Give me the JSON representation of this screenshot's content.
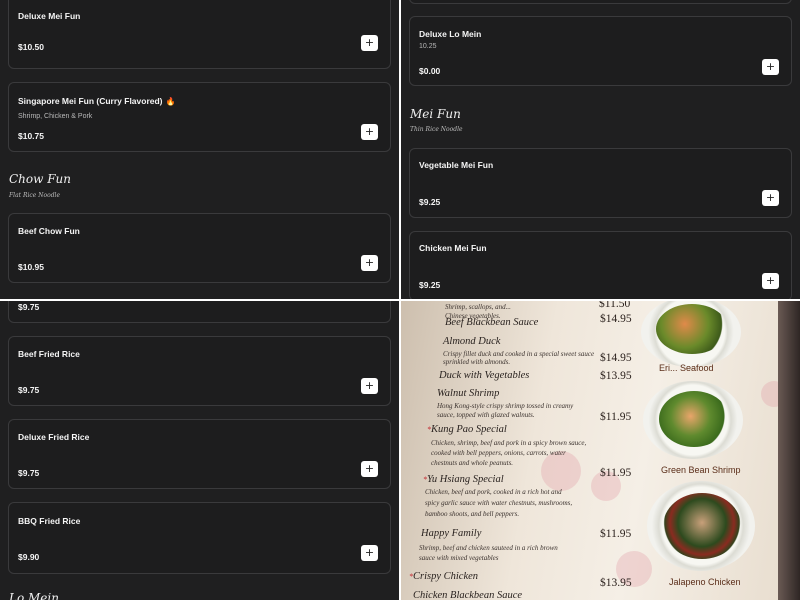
{
  "top_left": {
    "items": [
      {
        "name": "Deluxe Mei Fun",
        "price": "$10.50"
      },
      {
        "name": "Singapore Mei Fun (Curry Flavored)",
        "desc": "Shrimp, Chicken & Pork",
        "price": "$10.75"
      }
    ],
    "category": {
      "title": "Chow Fun",
      "subtitle": "Flat Rice Noodle"
    },
    "items2": [
      {
        "name": "Beef Chow Fun",
        "price": "$10.95"
      }
    ]
  },
  "top_right": {
    "items": [
      {
        "name": "Deluxe Lo Mein",
        "desc": "10.25",
        "price": "$0.00"
      }
    ],
    "category": {
      "title": "Mei Fun",
      "subtitle": "Thin Rice Noodle"
    },
    "items2": [
      {
        "name": "Vegetable Mei Fun",
        "price": "$9.25"
      },
      {
        "name": "Chicken Mei Fun",
        "price": "$9.25"
      }
    ]
  },
  "bottom_left": {
    "items": [
      {
        "price": "$9.75"
      },
      {
        "name": "Beef Fried Rice",
        "price": "$9.75"
      },
      {
        "name": "Deluxe Fried Rice",
        "price": "$9.75"
      },
      {
        "name": "BBQ Fried Rice",
        "price": "$9.90"
      }
    ],
    "partial_category": "Lo Mein"
  },
  "add_symbol": "+",
  "photo_menu": {
    "items": [
      {
        "name": "Shrimp, scallops, and...",
        "price": "$11.50",
        "desc": "Chinese vegetables."
      },
      {
        "name": "Beef Blackbean Sauce",
        "price": "$14.95"
      },
      {
        "name": "Almond Duck",
        "price": "$14.95",
        "desc1": "Crispy fillet duck and cooked in a special sweet sauce",
        "desc2": "sprinkled with almonds."
      },
      {
        "name": "Duck with Vegetables",
        "price": "$13.95"
      },
      {
        "name": "Walnut Shrimp",
        "price": "",
        "desc1": "Hong Kong-style crispy shrimp tossed in creamy",
        "desc2": "sauce, topped with glazed walnuts."
      },
      {
        "name": "Kung Pao Special",
        "price": "$11.95",
        "desc1": "Chicken, shrimp, beef and pork in a spicy brown sauce,",
        "desc2": "cooked with bell peppers, onions, carrots, water",
        "desc3": "chestnuts and whole peanuts."
      },
      {
        "name": "Yu Hsiang Special",
        "price": "$11.95",
        "desc1": "Chicken, beef and pork, cooked in a rich hot and",
        "desc2": "spicy garlic sauce with water chestnuts, mushrooms,",
        "desc3": "bamboo shoots, and bell peppers."
      },
      {
        "name": "Happy Family",
        "price": "$11.95",
        "desc1": "Shrimp, beef and chicken sauteed in a rich brown",
        "desc2": "sauce with mixed vegetables"
      },
      {
        "name": "Crispy Chicken",
        "price": "$13.95"
      },
      {
        "name": "Chicken Blackbean Sauce",
        "price": ""
      }
    ],
    "captions": [
      "Eri... Seafood",
      "Green Bean Shrimp",
      "Jalapeno Chicken"
    ],
    "star": "*"
  },
  "colors": {
    "background": "#1f1f20",
    "card_border": "#3a3a3c",
    "accent_flame": "#e0452b",
    "button": "#ffffff"
  }
}
